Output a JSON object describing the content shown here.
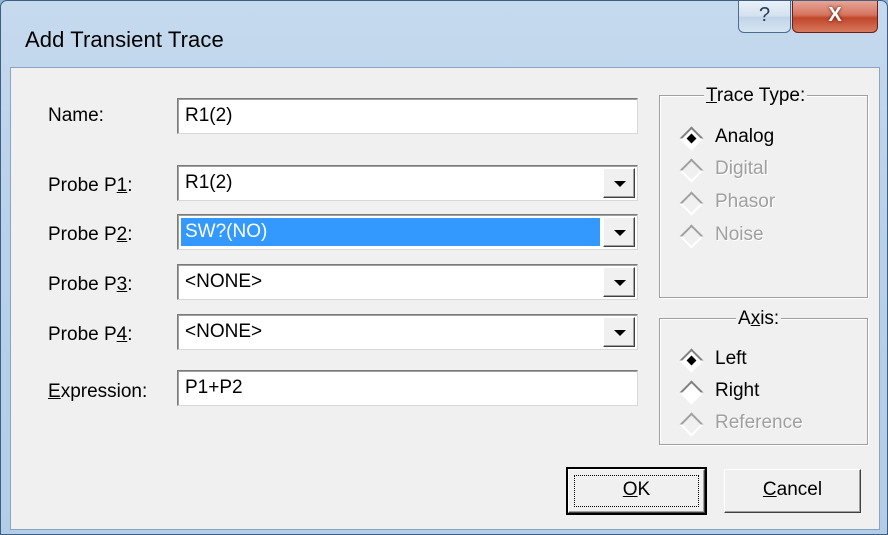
{
  "window": {
    "title": "Add Transient Trace",
    "help_glyph": "?",
    "close_glyph": "X"
  },
  "form": {
    "name": {
      "label": "Name:",
      "value": "R1(2)"
    },
    "probe_p1": {
      "label_pre": "Probe P",
      "label_key": "1",
      "label_post": ":",
      "value": "R1(2)"
    },
    "probe_p2": {
      "label_pre": "Probe P",
      "label_key": "2",
      "label_post": ":",
      "value": "SW?(NO)"
    },
    "probe_p3": {
      "label_pre": "Probe P",
      "label_key": "3",
      "label_post": ":",
      "value": "<NONE>"
    },
    "probe_p4": {
      "label_pre": "Probe P",
      "label_key": "4",
      "label_post": ":",
      "value": "<NONE>"
    },
    "expression": {
      "label_key": "E",
      "label_rest": "xpression:",
      "value": "P1+P2"
    }
  },
  "trace_type": {
    "title_key": "T",
    "title_rest": "race Type:",
    "options": [
      {
        "label": "Analog",
        "selected": true,
        "enabled": true
      },
      {
        "label": "Digital",
        "selected": false,
        "enabled": false
      },
      {
        "label": "Phasor",
        "selected": false,
        "enabled": false
      },
      {
        "label": "Noise",
        "selected": false,
        "enabled": false
      }
    ]
  },
  "axis": {
    "title_pre": "A",
    "title_key": "x",
    "title_rest": "is:",
    "options": [
      {
        "label": "Left",
        "selected": true,
        "enabled": true
      },
      {
        "label": "Right",
        "selected": false,
        "enabled": true
      },
      {
        "label": "Reference",
        "selected": false,
        "enabled": false
      }
    ]
  },
  "buttons": {
    "ok_key": "O",
    "ok_rest": "K",
    "cancel_key": "C",
    "cancel_rest": "ancel"
  },
  "icons": {
    "help": "help-icon",
    "close": "close-icon",
    "dropdown": "chevron-down-icon",
    "radio": "diamond-radio-icon"
  }
}
